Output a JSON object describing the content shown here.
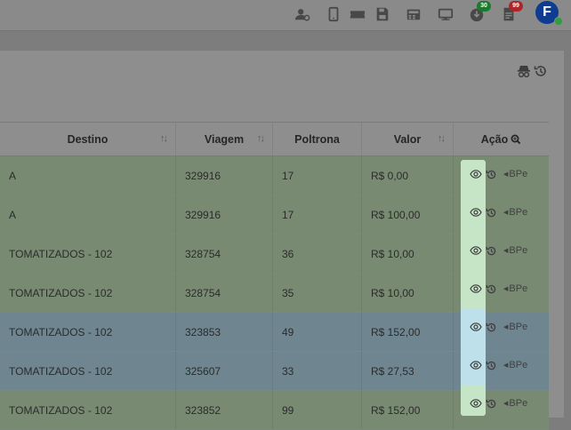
{
  "topbar": {
    "icons": [
      {
        "name": "user-settings-icon"
      },
      {
        "name": "mobile-icon"
      },
      {
        "name": "ticket-icon"
      },
      {
        "name": "save-icon"
      },
      {
        "name": "register-icon"
      },
      {
        "name": "monitor-icon"
      },
      {
        "name": "download-icon",
        "badge": "30",
        "badge_color": "#1c7a2d"
      },
      {
        "name": "document-icon",
        "badge": "99",
        "badge_color": "#a9262b"
      }
    ],
    "avatar_initial": "F",
    "avatar_color": "#0f3c91"
  },
  "panel": {
    "tool_icons": [
      "incognito-icon",
      "history-icon"
    ]
  },
  "table": {
    "headers": {
      "destino": "Destino",
      "viagem": "Viagem",
      "poltrona": "Poltrona",
      "valor": "Valor",
      "acao": "Ação"
    },
    "action_label": "BPe",
    "rows": [
      {
        "destino": "A",
        "viagem": "329916",
        "poltrona": "17",
        "valor": "R$ 0,00",
        "color": "green"
      },
      {
        "destino": "A",
        "viagem": "329916",
        "poltrona": "17",
        "valor": "R$ 100,00",
        "color": "green"
      },
      {
        "destino": "TOMATIZADOS - 102",
        "viagem": "328754",
        "poltrona": "36",
        "valor": "R$ 10,00",
        "color": "green"
      },
      {
        "destino": "TOMATIZADOS - 102",
        "viagem": "328754",
        "poltrona": "35",
        "valor": "R$ 10,00",
        "color": "green"
      },
      {
        "destino": "TOMATIZADOS - 102",
        "viagem": "323853",
        "poltrona": "49",
        "valor": "R$ 152,00",
        "color": "blue"
      },
      {
        "destino": "TOMATIZADOS - 102",
        "viagem": "325607",
        "poltrona": "33",
        "valor": "R$ 27,53",
        "color": "blue"
      },
      {
        "destino": "TOMATIZADOS - 102",
        "viagem": "323852",
        "poltrona": "99",
        "valor": "R$ 152,00",
        "color": "green"
      }
    ]
  },
  "colors": {
    "row_green": "#798a73",
    "row_blue": "#6f8690",
    "action_highlight_green": "#c5e5c6",
    "action_highlight_blue": "#bde0ea"
  }
}
